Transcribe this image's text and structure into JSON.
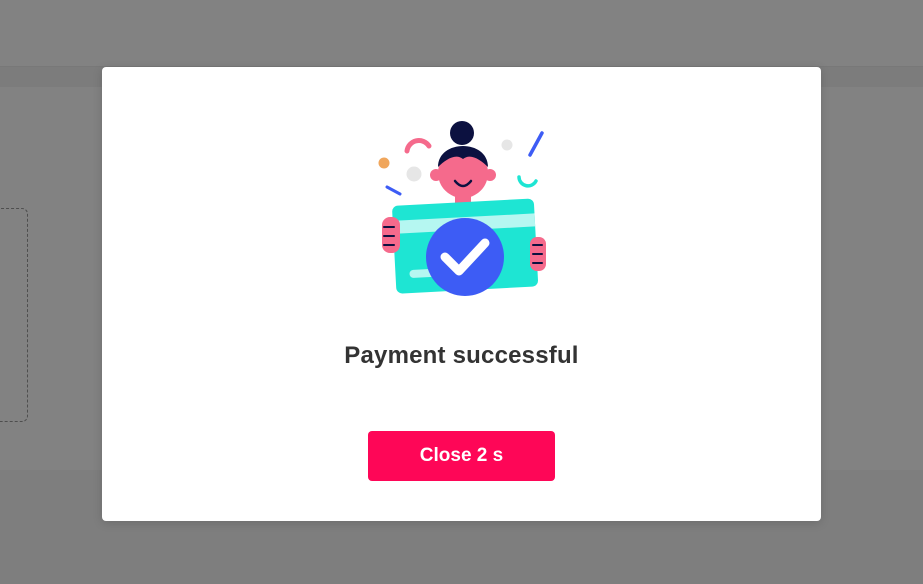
{
  "modal": {
    "title": "Payment successful",
    "close_button_label": "Close 2 s"
  },
  "illustration": {
    "icon": "payment-success-illustration",
    "check_icon": "checkmark-icon"
  },
  "colors": {
    "overlay": "#000000",
    "primary_button": "#fe0657",
    "check_circle": "#3d5cf5",
    "card": "#1ee5d3",
    "skin": "#f56a8c",
    "hair": "#0c1140",
    "title_text": "#333333"
  }
}
